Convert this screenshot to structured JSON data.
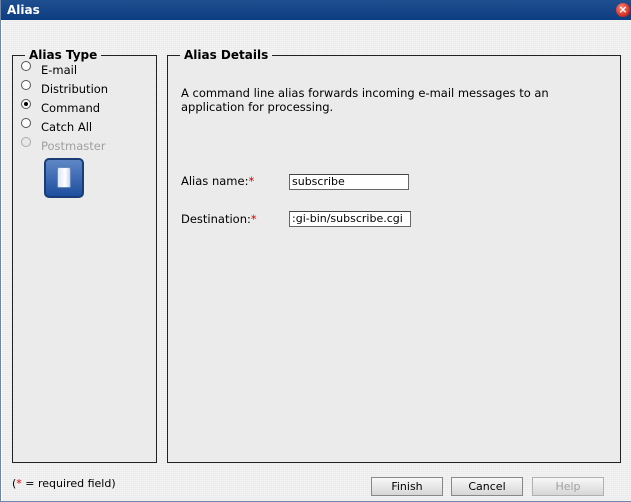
{
  "window": {
    "title": "Alias"
  },
  "alias_type": {
    "legend": "Alias Type",
    "options": [
      {
        "label": "E-mail",
        "checked": false,
        "disabled": false
      },
      {
        "label": "Distribution",
        "checked": false,
        "disabled": false
      },
      {
        "label": "Command",
        "checked": true,
        "disabled": false
      },
      {
        "label": "Catch All",
        "checked": false,
        "disabled": false
      },
      {
        "label": "Postmaster",
        "checked": false,
        "disabled": true
      }
    ],
    "icon": "command-scroll-icon"
  },
  "alias_details": {
    "legend": "Alias Details",
    "description": "A command line alias forwards incoming e-mail messages to an application for processing.",
    "alias_name": {
      "label": "Alias name:",
      "required_mark": "*",
      "value": "subscribe"
    },
    "destination": {
      "label": "Destination:",
      "required_mark": "*",
      "value": ":gi-bin/subscribe.cgi"
    }
  },
  "footer": {
    "required_note_open": "(",
    "required_note_star": "*",
    "required_note_rest": " = required field)",
    "finish_label": "Finish",
    "cancel_label": "Cancel",
    "help_label": "Help"
  },
  "colors": {
    "titlebar": "#0d3d82",
    "required_star": "#cc0000",
    "disabled_text": "#a0a0a0"
  }
}
